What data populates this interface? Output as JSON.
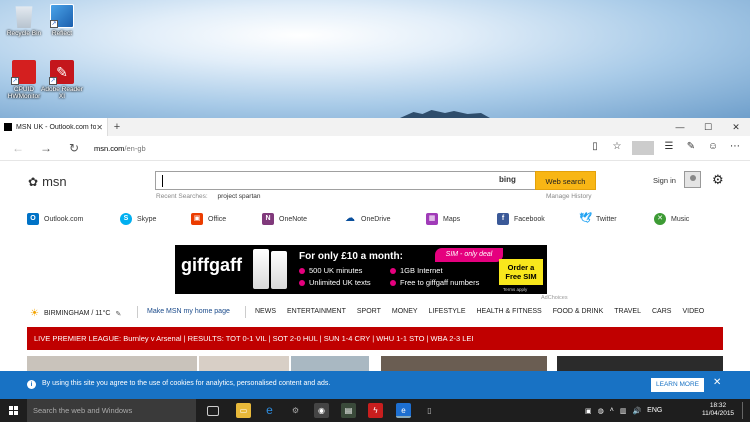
{
  "desktop": {
    "icons": [
      {
        "label": "Recycle Bin"
      },
      {
        "label": "Reflect"
      },
      {
        "label": "CPUID HWMonitor"
      },
      {
        "label": "Adobe Reader XI"
      }
    ]
  },
  "browser": {
    "tab_title": "MSN UK - Outlook.com fo",
    "url_host": "msn.com",
    "url_path": "/en-gb"
  },
  "msn": {
    "logo": "msn",
    "search_button": "Web search",
    "bing": "bing",
    "recent_label": "Recent Searches:",
    "recent_item": "project spartan",
    "manage_history": "Manage History",
    "sign_in": "Sign in",
    "apps": [
      {
        "label": "Outlook.com",
        "icon": "outlook-icon",
        "color": "#0072c6"
      },
      {
        "label": "Skype",
        "icon": "skype-icon",
        "color": "#00aff0"
      },
      {
        "label": "Office",
        "icon": "office-icon",
        "color": "#eb3c00"
      },
      {
        "label": "OneNote",
        "icon": "onenote-icon",
        "color": "#80397b"
      },
      {
        "label": "OneDrive",
        "icon": "onedrive-icon",
        "color": "#0a4f9c"
      },
      {
        "label": "Maps",
        "icon": "maps-icon",
        "color": "#a03bb8"
      },
      {
        "label": "Facebook",
        "icon": "facebook-icon",
        "color": "#3b5998"
      },
      {
        "label": "Twitter",
        "icon": "twitter-icon",
        "color": "#1da1f2"
      },
      {
        "label": "Music",
        "icon": "music-icon",
        "color": "#3d9b35"
      }
    ],
    "ad": {
      "brand": "giffgaff",
      "headline": "For only £10 a month:",
      "lines": [
        "500 UK minutes",
        "Unlimited UK texts",
        "1GB Internet",
        "Free to giffgaff numbers"
      ],
      "badge": "SIM - only deal",
      "cta": "Order a Free SIM",
      "terms": "Terms apply",
      "adchoices": "AdChoices"
    },
    "weather": "BIRMINGHAM / 11°C",
    "make_home": "Make MSN my home page",
    "nav": [
      "NEWS",
      "ENTERTAINMENT",
      "SPORT",
      "MONEY",
      "LIFESTYLE",
      "HEALTH & FITNESS",
      "FOOD & DRINK",
      "TRAVEL",
      "CARS",
      "VIDEO"
    ],
    "ticker": "LIVE PREMIER LEAGUE: Burnley v Arsenal | RESULTS: TOT 0-1 VIL | SOT 2-0 HUL | SUN 1-4 CRY | WHU 1-1 STO | WBA 2-3 LEI",
    "cookie_msg": "By using this site you agree to the use of cookies for analytics, personalised content and ads.",
    "learn_more": "LEARN MORE"
  },
  "taskbar": {
    "search_placeholder": "Search the web and Windows",
    "lang": "ENG",
    "time": "18:32",
    "date": "11/04/2015"
  }
}
